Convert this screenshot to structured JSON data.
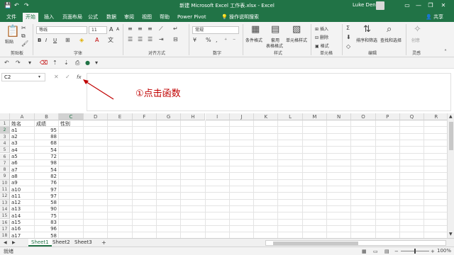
{
  "titlebar": {
    "title": "新建 Microsoft Excel 工作表.xlsx  -  Excel",
    "user": "Luke Deng",
    "minimize": "—",
    "restore": "❐",
    "close": "✕",
    "save_icon": "save-icon",
    "undo_icon": "undo-icon",
    "redo_icon": "redo-icon"
  },
  "tabs": [
    "文件",
    "开始",
    "插入",
    "页面布局",
    "公式",
    "数据",
    "审阅",
    "视图",
    "帮助",
    "Power Pivot"
  ],
  "active_tab": "开始",
  "tell_me": "操作说明搜索",
  "share": "共享",
  "ribbon": {
    "clipboard": {
      "paste": "粘贴",
      "label": "剪贴板"
    },
    "font": {
      "name": "等线",
      "size": "11",
      "bold": "B",
      "italic": "I",
      "underline": "U",
      "grow": "A",
      "shrink": "A",
      "label": "字体"
    },
    "alignment": {
      "label": "对齐方式"
    },
    "number": {
      "format": "常规",
      "label": "数字"
    },
    "styles": {
      "conditional": "条件格式",
      "table_format_1": "套用",
      "table_format_2": "表格格式",
      "cell_styles": "单元格样式",
      "label": "样式"
    },
    "cells": {
      "insert": "插入",
      "delete": "删除",
      "format": "格式",
      "label": "单元格"
    },
    "editing": {
      "sort_filter": "排序和筛选",
      "find_select": "查找和选择",
      "label": "编辑"
    },
    "ideas": {
      "button": "创意",
      "label": "灵感"
    }
  },
  "formula_bar": {
    "name_box": "C2",
    "cancel": "✕",
    "enter": "✓",
    "fx": "fx",
    "value": ""
  },
  "annotation": "①点击函数",
  "columns": [
    "A",
    "B",
    "C",
    "D",
    "E",
    "F",
    "G",
    "H",
    "I",
    "J",
    "K",
    "L",
    "M",
    "N",
    "O",
    "P",
    "Q",
    "R"
  ],
  "rows": [
    {
      "num": "1",
      "a": "姓名",
      "b": "成绩",
      "c": "性别"
    },
    {
      "num": "2",
      "a": "a1",
      "b": "95",
      "c": ""
    },
    {
      "num": "3",
      "a": "a2",
      "b": "88",
      "c": ""
    },
    {
      "num": "4",
      "a": "a3",
      "b": "68",
      "c": ""
    },
    {
      "num": "5",
      "a": "a4",
      "b": "54",
      "c": ""
    },
    {
      "num": "6",
      "a": "a5",
      "b": "72",
      "c": ""
    },
    {
      "num": "7",
      "a": "a6",
      "b": "98",
      "c": ""
    },
    {
      "num": "8",
      "a": "a7",
      "b": "54",
      "c": ""
    },
    {
      "num": "9",
      "a": "a8",
      "b": "82",
      "c": ""
    },
    {
      "num": "10",
      "a": "a9",
      "b": "76",
      "c": ""
    },
    {
      "num": "11",
      "a": "a10",
      "b": "97",
      "c": ""
    },
    {
      "num": "12",
      "a": "a11",
      "b": "97",
      "c": ""
    },
    {
      "num": "13",
      "a": "a12",
      "b": "58",
      "c": ""
    },
    {
      "num": "14",
      "a": "a13",
      "b": "90",
      "c": ""
    },
    {
      "num": "15",
      "a": "a14",
      "b": "75",
      "c": ""
    },
    {
      "num": "16",
      "a": "a15",
      "b": "83",
      "c": ""
    },
    {
      "num": "17",
      "a": "a16",
      "b": "96",
      "c": ""
    },
    {
      "num": "18",
      "a": "a17",
      "b": "58",
      "c": ""
    }
  ],
  "sheets": [
    "Sheet1",
    "Sheet2",
    "Sheet3"
  ],
  "active_sheet": "Sheet1",
  "add_sheet": "+",
  "status": {
    "mode": "就绪",
    "zoom": "100%"
  },
  "colors": {
    "accent": "#217346",
    "annotation": "#c00000"
  }
}
